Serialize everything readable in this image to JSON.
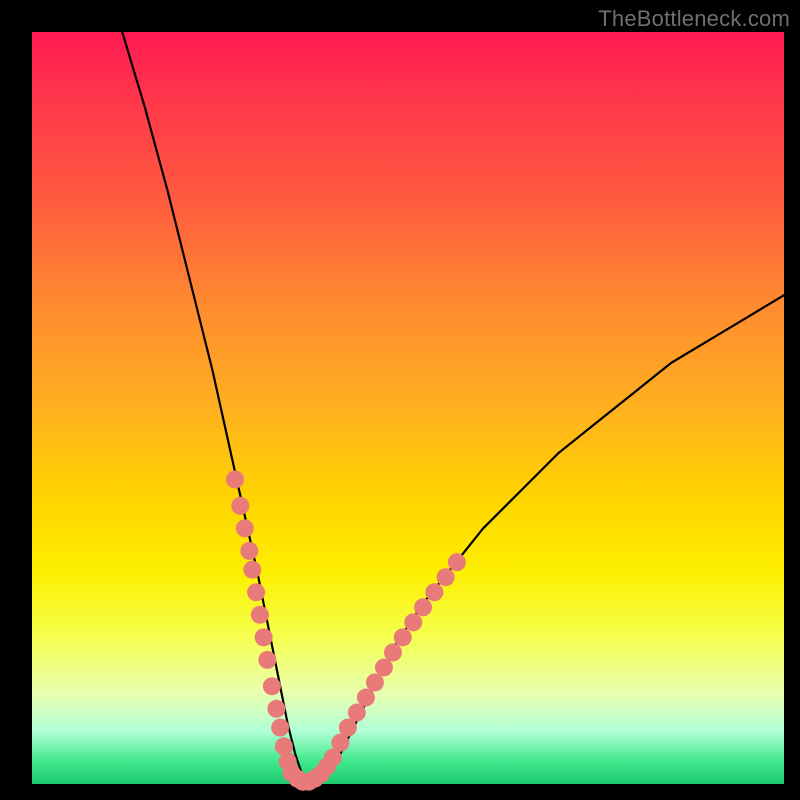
{
  "watermark": "TheBottleneck.com",
  "chart_data": {
    "type": "line",
    "title": "",
    "xlabel": "",
    "ylabel": "",
    "xlim": [
      0,
      100
    ],
    "ylim": [
      0,
      100
    ],
    "grid": false,
    "series": [
      {
        "name": "curve",
        "color": "#000000",
        "x": [
          12,
          15,
          18,
          21,
          24,
          26,
          28,
          30,
          31,
          32,
          33,
          34,
          35,
          36,
          37,
          38,
          40,
          42,
          45,
          48,
          52,
          56,
          60,
          65,
          70,
          75,
          80,
          85,
          90,
          95,
          100
        ],
        "values": [
          100,
          90,
          79,
          67,
          55,
          46,
          37,
          28,
          23,
          18,
          13,
          8,
          4,
          1,
          0,
          0,
          2,
          6,
          12,
          18,
          24,
          29,
          34,
          39,
          44,
          48,
          52,
          56,
          59,
          62,
          65
        ]
      },
      {
        "name": "dots-left",
        "type": "scatter",
        "color": "#e97a7a",
        "x": [
          27.0,
          27.7,
          28.3,
          28.9,
          29.3,
          29.8,
          30.3,
          30.8,
          31.3,
          31.9,
          32.5,
          33.0,
          33.5,
          34.0
        ],
        "values": [
          40.5,
          37.0,
          34.0,
          31.0,
          28.5,
          25.5,
          22.5,
          19.5,
          16.5,
          13.0,
          10.0,
          7.5,
          5.0,
          3.0
        ]
      },
      {
        "name": "dots-bottom",
        "type": "scatter",
        "color": "#e97a7a",
        "x": [
          34.5,
          35.3,
          36.0,
          36.8,
          37.6,
          38.4,
          39.2
        ],
        "values": [
          1.5,
          0.7,
          0.3,
          0.3,
          0.7,
          1.3,
          2.3
        ]
      },
      {
        "name": "dots-right",
        "type": "scatter",
        "color": "#e97a7a",
        "x": [
          40.0,
          41.0,
          42.0,
          43.2,
          44.4,
          45.6,
          46.8,
          48.0,
          49.3,
          50.7,
          52.0,
          53.5,
          55.0,
          56.5
        ],
        "values": [
          3.5,
          5.5,
          7.5,
          9.5,
          11.5,
          13.5,
          15.5,
          17.5,
          19.5,
          21.5,
          23.5,
          25.5,
          27.5,
          29.5
        ]
      }
    ]
  }
}
